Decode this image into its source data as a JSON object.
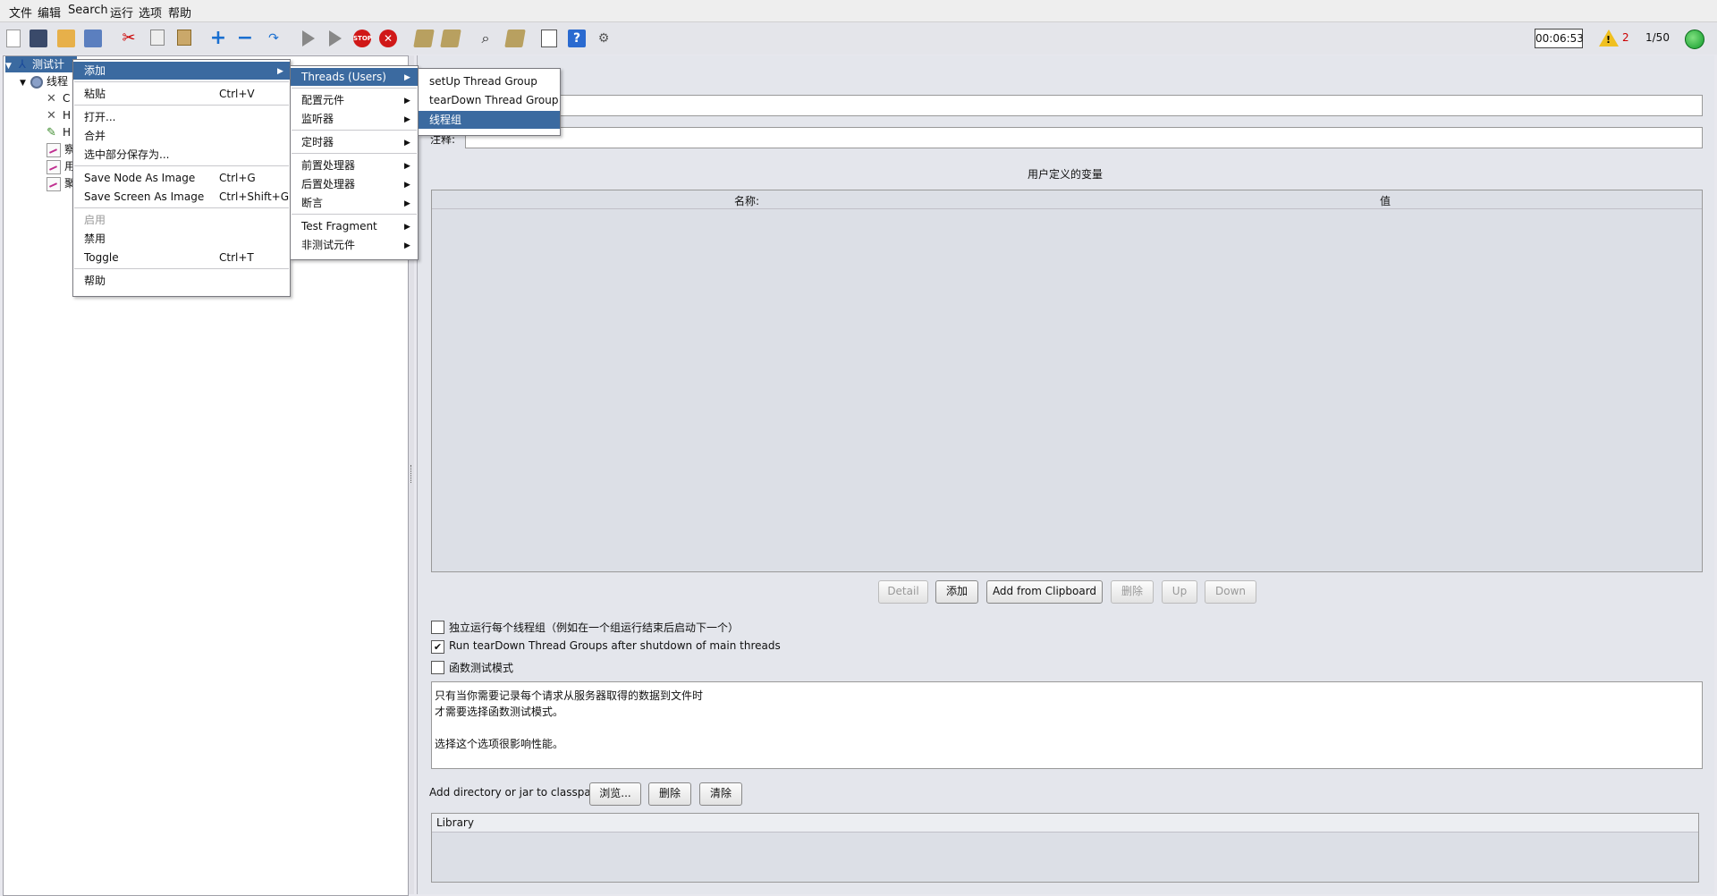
{
  "menubar": [
    "文件",
    "编辑",
    "Search",
    "运行",
    "选项",
    "帮助"
  ],
  "toolbar": {
    "timer": "00:06:53",
    "warning_count": "2",
    "thread_ratio": "1/50"
  },
  "tree": {
    "root_label": "测试计",
    "thread_group_label": "线程",
    "child_initials": [
      "C",
      "H",
      "H",
      "察",
      "用",
      "聚"
    ]
  },
  "context_menu": {
    "items": [
      {
        "label": "添加",
        "accel": ""
      },
      {
        "label": "粘贴",
        "accel": "Ctrl+V"
      },
      {
        "label": "打开...",
        "accel": ""
      },
      {
        "label": "合并",
        "accel": ""
      },
      {
        "label": "选中部分保存为...",
        "accel": ""
      },
      {
        "label": "Save Node As Image",
        "accel": "Ctrl+G"
      },
      {
        "label": "Save Screen As Image",
        "accel": "Ctrl+Shift+G"
      },
      {
        "label": "启用",
        "accel": ""
      },
      {
        "label": "禁用",
        "accel": ""
      },
      {
        "label": "Toggle",
        "accel": "Ctrl+T"
      },
      {
        "label": "帮助",
        "accel": ""
      }
    ]
  },
  "add_submenu": {
    "items": [
      "Threads (Users)",
      "配置元件",
      "监听器",
      "定时器",
      "前置处理器",
      "后置处理器",
      "断言",
      "Test Fragment",
      "非测试元件"
    ]
  },
  "threads_submenu": {
    "items": [
      "setUp Thread Group",
      "tearDown Thread Group",
      "线程组"
    ]
  },
  "right": {
    "comment_label": "注释:",
    "vars_title": "用户定义的变量",
    "col_name": "名称:",
    "col_value": "值",
    "buttons": {
      "detail": "Detail",
      "add": "添加",
      "add_clipboard": "Add from Clipboard",
      "delete": "删除",
      "up": "Up",
      "down": "Down"
    },
    "checkboxes": [
      {
        "label": "独立运行每个线程组（例如在一个组运行结束后启动下一个）",
        "checked": false
      },
      {
        "label": "Run tearDown Thread Groups after shutdown of main threads",
        "checked": true
      },
      {
        "label": "函数测试模式",
        "checked": false
      }
    ],
    "info_lines": [
      "只有当你需要记录每个请求从服务器取得的数据到文件时",
      "才需要选择函数测试模式。",
      "选择这个选项很影响性能。"
    ],
    "classpath_label": "Add directory or jar to classpath",
    "classpath_buttons": {
      "browse": "浏览...",
      "delete": "删除",
      "clear": "清除"
    },
    "library_header": "Library"
  }
}
